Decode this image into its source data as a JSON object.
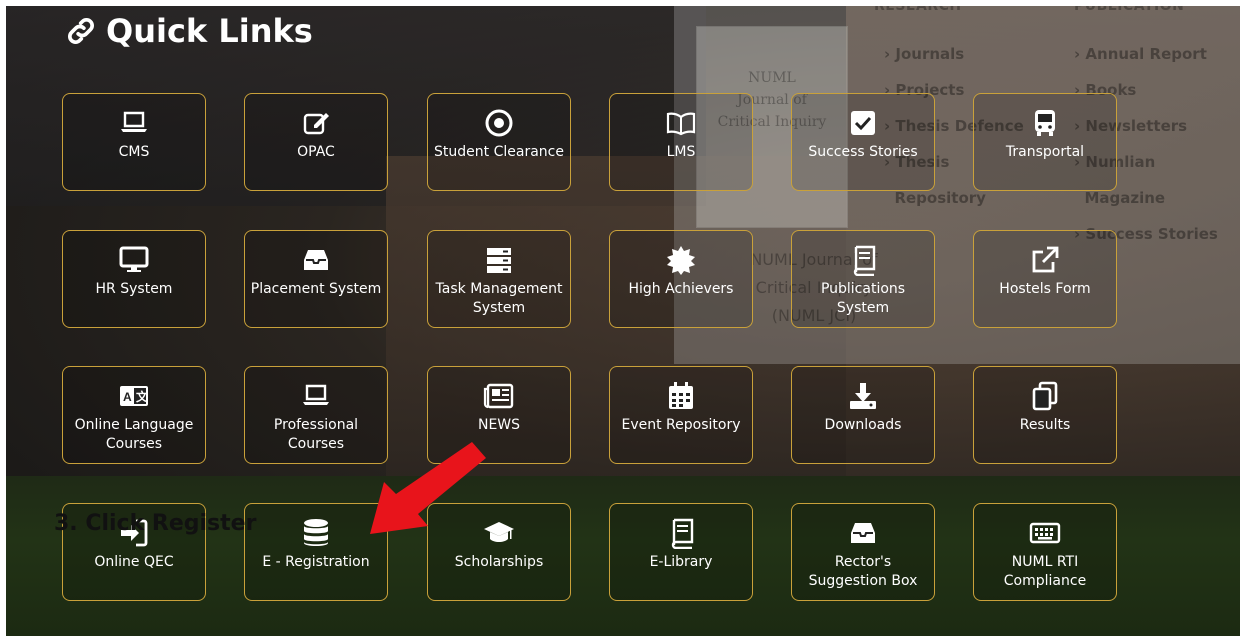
{
  "page": {
    "title": "Quick Links"
  },
  "background_ghost": {
    "col1_header": "RESEARCH",
    "col2_header": "PUBLICATION",
    "col1_items": [
      "Journals",
      "Projects",
      "Thesis Defence",
      "Thesis",
      "Repository"
    ],
    "col2_items": [
      "Annual Report",
      "Books",
      "Newsletters",
      "Numlian",
      "Magazine",
      "Success Stories"
    ],
    "journal_cover": [
      "NUML",
      "Journal of",
      "Critical Inquiry"
    ],
    "journal_title": [
      "NUML Journal of",
      "Critical Inquiry",
      "(NUML JCI)"
    ]
  },
  "tiles": [
    {
      "label": "CMS",
      "icon": "laptop-icon"
    },
    {
      "label": "OPAC",
      "icon": "edit-icon"
    },
    {
      "label": "Student Clearance",
      "icon": "target-icon"
    },
    {
      "label": "LMS",
      "icon": "book-open-icon"
    },
    {
      "label": "Success Stories",
      "icon": "check-square-icon"
    },
    {
      "label": "Transportal",
      "icon": "bus-icon"
    },
    {
      "label": "HR System",
      "icon": "desktop-icon"
    },
    {
      "label": "Placement System",
      "icon": "inbox-icon"
    },
    {
      "label": "Task Management System",
      "icon": "server-icon"
    },
    {
      "label": "High Achievers",
      "icon": "certificate-icon"
    },
    {
      "label": "Publications System",
      "icon": "book-icon"
    },
    {
      "label": "Hostels Form",
      "icon": "external-link-icon"
    },
    {
      "label": "Online Language Courses",
      "icon": "language-icon"
    },
    {
      "label": "Professional Courses",
      "icon": "laptop-icon"
    },
    {
      "label": "NEWS",
      "icon": "newspaper-icon"
    },
    {
      "label": "Event Repository",
      "icon": "calendar-icon"
    },
    {
      "label": "Downloads",
      "icon": "download-icon"
    },
    {
      "label": "Results",
      "icon": "copy-icon"
    },
    {
      "label": "Online QEC",
      "icon": "sign-in-icon"
    },
    {
      "label": "E - Registration",
      "icon": "database-icon"
    },
    {
      "label": "Scholarships",
      "icon": "graduation-cap-icon"
    },
    {
      "label": "E-Library",
      "icon": "book-icon"
    },
    {
      "label": "Rector's Suggestion Box",
      "icon": "inbox-icon"
    },
    {
      "label": "NUML RTI Compliance",
      "icon": "keyboard-icon"
    }
  ],
  "annotation": {
    "step_text": "3. Click Register",
    "arrow_color": "#e8141b"
  },
  "colors": {
    "tile_border": "#c9a13a",
    "text": "#ffffff"
  }
}
